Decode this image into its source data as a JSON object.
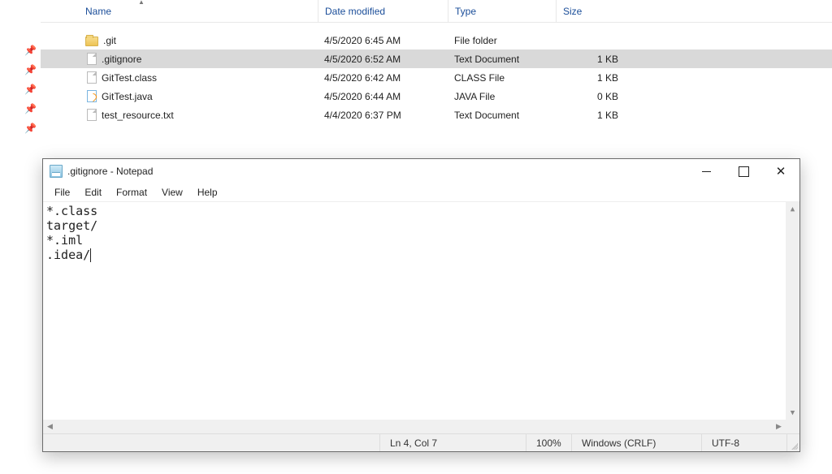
{
  "explorer": {
    "columns": {
      "name": "Name",
      "date": "Date modified",
      "type": "Type",
      "size": "Size"
    },
    "rows": [
      {
        "icon": "folder",
        "name": ".git",
        "date": "4/5/2020 6:45 AM",
        "type": "File folder",
        "size": "",
        "selected": false
      },
      {
        "icon": "file",
        "name": ".gitignore",
        "date": "4/5/2020 6:52 AM",
        "type": "Text Document",
        "size": "1 KB",
        "selected": true
      },
      {
        "icon": "file",
        "name": "GitTest.class",
        "date": "4/5/2020 6:42 AM",
        "type": "CLASS File",
        "size": "1 KB",
        "selected": false
      },
      {
        "icon": "java",
        "name": "GitTest.java",
        "date": "4/5/2020 6:44 AM",
        "type": "JAVA File",
        "size": "0 KB",
        "selected": false
      },
      {
        "icon": "file",
        "name": "test_resource.txt",
        "date": "4/4/2020 6:37 PM",
        "type": "Text Document",
        "size": "1 KB",
        "selected": false
      }
    ]
  },
  "notepad": {
    "title": ".gitignore - Notepad",
    "menu": {
      "file": "File",
      "edit": "Edit",
      "format": "Format",
      "view": "View",
      "help": "Help"
    },
    "content": "*.class\ntarget/\n*.iml\n.idea/",
    "status": {
      "position": "Ln 4, Col 7",
      "zoom": "100%",
      "eol": "Windows (CRLF)",
      "encoding": "UTF-8"
    }
  }
}
